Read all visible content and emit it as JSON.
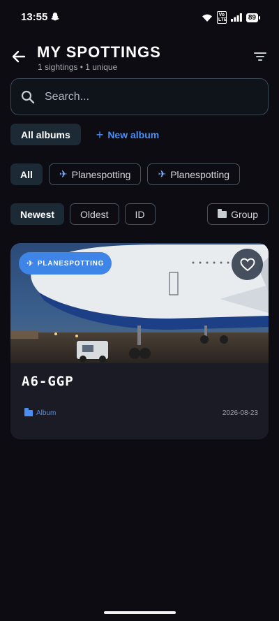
{
  "status_bar": {
    "time": "13:55",
    "battery": "89",
    "volte": "Vo LTE",
    "icons": [
      "snapchat-icon",
      "wifi-icon",
      "volte-icon",
      "signal-icon",
      "battery-icon"
    ]
  },
  "header": {
    "title": "MY SPOTTINGS",
    "subtitle": "1 sightings • 1 unique",
    "icons": [
      "back-arrow-icon",
      "filter-icon"
    ]
  },
  "search": {
    "placeholder": "Search...",
    "value": ""
  },
  "albums": {
    "all_label": "All albums",
    "new_album_plus": "+",
    "new_album_label": "New album"
  },
  "categories": [
    {
      "label": "All",
      "selected": true
    },
    {
      "emoji": "✈",
      "label": "Planespotting",
      "selected": false
    },
    {
      "emoji": "✈",
      "label": "Planespotting",
      "selected": false
    }
  ],
  "sort": {
    "options": [
      {
        "label": "Newest",
        "selected": true
      },
      {
        "label": "Oldest",
        "selected": false
      },
      {
        "label": "ID",
        "selected": false
      }
    ],
    "group_label": "Group"
  },
  "cards": [
    {
      "badge_emoji": "✈",
      "badge": "PLANESPOTTING",
      "registration": "A6-GGP",
      "album": "Album",
      "date": "2026-08-23",
      "favorite": false
    }
  ],
  "colors": {
    "background": "#0c0c12",
    "accent": "#4b8ff5",
    "chip_selected": "#1b2a35",
    "card": "#1a1b24",
    "badge": "#3f85e8"
  }
}
